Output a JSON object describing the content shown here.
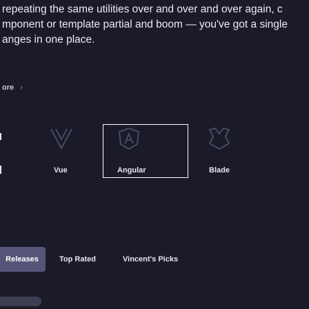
{
  "intro": {
    "line1": "repeating the same utilities over and over and over again, c",
    "line2": "mponent or template partial and boom — you've got a single",
    "line3": "anges in one place."
  },
  "breadcrumb": {
    "label": "ore",
    "chevron": "›"
  },
  "cards": [
    {
      "icon": "vue-icon",
      "label": "Vue"
    },
    {
      "icon": "angular-icon",
      "label": "Angular"
    },
    {
      "icon": "blade-icon",
      "label": "Blade"
    }
  ],
  "tabs": {
    "items": [
      "Releases",
      "Top Rated",
      "Vincent's Picks"
    ],
    "active": "Releases"
  },
  "colors": {
    "background": "#1a1a28",
    "active_tab": "#55557a",
    "icon_stroke": "#4a4a66"
  }
}
